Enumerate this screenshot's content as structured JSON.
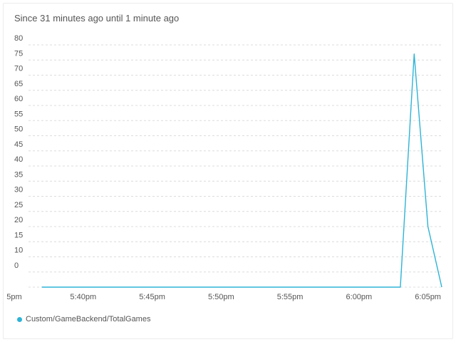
{
  "header": {
    "subtitle": "Since 31 minutes ago until 1 minute ago"
  },
  "colors": {
    "series": "#2eb3d6",
    "grid": "#dcdcdc",
    "axis_text": "#555555"
  },
  "chart_data": {
    "type": "line",
    "title": "",
    "xlabel": "",
    "ylabel": "",
    "ylim": [
      0,
      80
    ],
    "yticks": [
      0,
      5,
      10,
      15,
      20,
      25,
      30,
      35,
      40,
      45,
      50,
      55,
      60,
      65,
      70,
      75,
      80
    ],
    "ytick_labels": [
      "0",
      "10",
      "15",
      "20",
      "25",
      "30",
      "35",
      "40",
      "45",
      "50",
      "55",
      "60",
      "65",
      "70",
      "75",
      "80"
    ],
    "xlim": [
      "5:35pm",
      "6:06pm"
    ],
    "xticks": [
      "5:35pm",
      "5:40pm",
      "5:45pm",
      "5:50pm",
      "5:55pm",
      "6:00pm",
      "6:05pm"
    ],
    "xtick_labels": [
      "5pm",
      "5:40pm",
      "5:45pm",
      "5:50pm",
      "5:55pm",
      "6:00pm",
      "6:05pm"
    ],
    "grid": true,
    "grid_style": "dashed-horizontal",
    "legend_position": "bottom-left",
    "series": [
      {
        "name": "Custom/GameBackend/TotalGames",
        "color": "#2eb3d6",
        "points": [
          {
            "x": "5:37pm",
            "y": 0
          },
          {
            "x": "6:03pm",
            "y": 0
          },
          {
            "x": "6:04pm",
            "y": 77
          },
          {
            "x": "6:05pm",
            "y": 20
          },
          {
            "x": "6:06pm",
            "y": 0
          }
        ]
      }
    ]
  }
}
